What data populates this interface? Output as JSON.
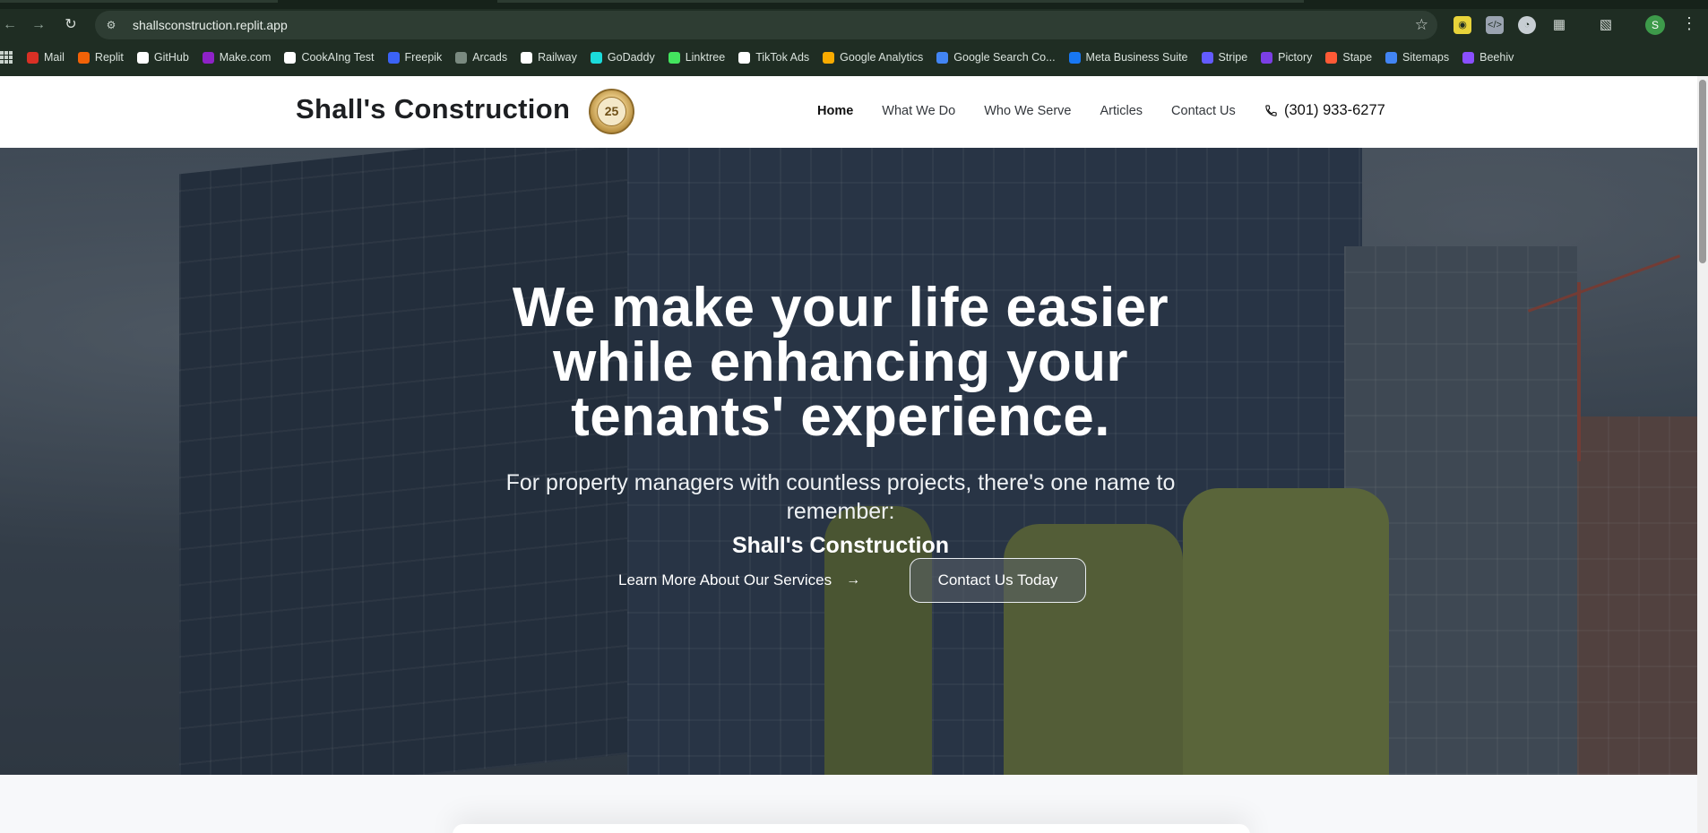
{
  "browser": {
    "url": "shallsconstruction.replit.app",
    "avatar_letter": "S",
    "bookmarks": [
      {
        "label": "Mail",
        "icon": "gmail-icon",
        "color": "#d93025"
      },
      {
        "label": "Replit",
        "icon": "replit-icon",
        "color": "#f26207"
      },
      {
        "label": "GitHub",
        "icon": "github-icon",
        "color": "#ffffff"
      },
      {
        "label": "Make.com",
        "icon": "make-icon",
        "color": "#8e22c8"
      },
      {
        "label": "CookAIng Test",
        "icon": "triangle-icon",
        "color": "#ffffff"
      },
      {
        "label": "Freepik",
        "icon": "freepik-icon",
        "color": "#3b63f6"
      },
      {
        "label": "Arcads",
        "icon": "arcads-icon",
        "color": "#7a8a80"
      },
      {
        "label": "Railway",
        "icon": "railway-icon",
        "color": "#ffffff"
      },
      {
        "label": "GoDaddy",
        "icon": "godaddy-icon",
        "color": "#1bdbdb"
      },
      {
        "label": "Linktree",
        "icon": "linktree-icon",
        "color": "#43e55e"
      },
      {
        "label": "TikTok Ads",
        "icon": "tiktok-icon",
        "color": "#ffffff"
      },
      {
        "label": "Google Analytics",
        "icon": "analytics-icon",
        "color": "#f9ab00"
      },
      {
        "label": "Google Search Co...",
        "icon": "search-console-icon",
        "color": "#4285f4"
      },
      {
        "label": "Meta Business Suite",
        "icon": "meta-icon",
        "color": "#1877f2"
      },
      {
        "label": "Stripe",
        "icon": "stripe-icon",
        "color": "#635bff"
      },
      {
        "label": "Pictory",
        "icon": "pictory-icon",
        "color": "#7b3fe4"
      },
      {
        "label": "Stape",
        "icon": "stape-icon",
        "color": "#ff5a36"
      },
      {
        "label": "Sitemaps",
        "icon": "sitemaps-icon",
        "color": "#4285f4"
      },
      {
        "label": "Beehiv",
        "icon": "beehiiv-icon",
        "color": "#8a4fff"
      }
    ]
  },
  "site": {
    "brand": "Shall's Construction",
    "badge_text": "25",
    "nav": [
      {
        "label": "Home",
        "active": true
      },
      {
        "label": "What We Do",
        "active": false
      },
      {
        "label": "Who We Serve",
        "active": false
      },
      {
        "label": "Articles",
        "active": false
      },
      {
        "label": "Contact Us",
        "active": false
      }
    ],
    "phone": "(301) 933-6277"
  },
  "hero": {
    "title": "We make your life easier while enhancing your tenants' experience.",
    "subtitle": "For property managers with countless projects, there's one name to remember:",
    "brand_line": "Shall's Construction",
    "cta_learn": "Learn More About Our Services",
    "cta_contact": "Contact Us Today"
  }
}
